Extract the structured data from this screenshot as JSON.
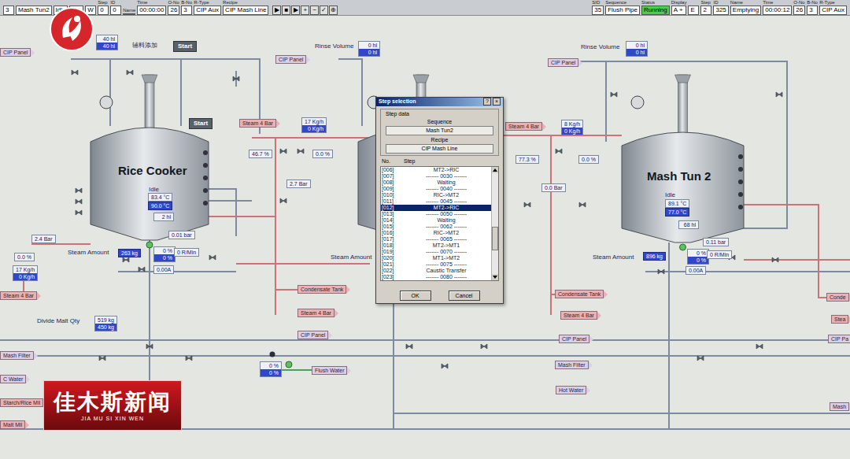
{
  "toolbar": {
    "left_cells": [
      {
        "value": "3"
      },
      {
        "value": "Mash Tun2"
      },
      {
        "value": "Idle"
      },
      {
        "value": "A +"
      },
      {
        "value": "W"
      },
      {
        "header": "Step",
        "value": "0"
      },
      {
        "header": "ID",
        "value": "0"
      },
      {
        "header": "Name",
        "value": ""
      },
      {
        "header": "Time",
        "value": "00:00:00"
      },
      {
        "header": "O-No",
        "value": "26"
      },
      {
        "header": "B-No",
        "value": "3"
      },
      {
        "header": "R-Type",
        "value": "CIP Aux"
      },
      {
        "header": "Recipe",
        "value": "CIP Mash Line"
      }
    ],
    "controls": [
      "▶",
      "■",
      "▶",
      "+",
      "−",
      "✓",
      "⊕"
    ],
    "right_cells": [
      {
        "header": "SID",
        "value": "35"
      },
      {
        "header": "Sequence",
        "value": "Flush Pipe"
      },
      {
        "header": "Status",
        "value": "Running",
        "kind": "status"
      },
      {
        "header": "Display",
        "value": "A +"
      },
      {
        "value": "E"
      },
      {
        "header": "Step",
        "value": "2"
      },
      {
        "header": "ID",
        "value": "325"
      },
      {
        "header": "Name",
        "value": "Emptying"
      },
      {
        "header": "Time",
        "value": "00:00:12"
      },
      {
        "header": "O-No",
        "value": "26"
      },
      {
        "header": "B-No",
        "value": "3"
      },
      {
        "header": "R-Type",
        "value": "CIP Aux"
      }
    ]
  },
  "items": [
    {
      "kind": "dual",
      "top": "40 hl",
      "bottom": "40 hl"
    },
    {
      "kind": "text",
      "text": "辅料添加"
    },
    {
      "kind": "button",
      "text": "Start"
    },
    {
      "kind": "tag",
      "text": "CIP Panel",
      "color": "#d8d0e6"
    },
    {
      "kind": "button",
      "text": "Start"
    },
    {
      "kind": "title",
      "text": "Rice Cooker"
    },
    {
      "kind": "text",
      "text": "Idle"
    },
    {
      "kind": "value",
      "text": "83.4 °C"
    },
    {
      "kind": "setpoint",
      "text": "90.0 °C"
    },
    {
      "kind": "value",
      "text": "2 hl"
    },
    {
      "kind": "tag",
      "text": "Steam 4 Bar",
      "color": "#e9b3b6"
    },
    {
      "kind": "dual",
      "top": "17 Kg/h",
      "bottom": "0 Kg/h"
    },
    {
      "kind": "value",
      "text": "46.7 %"
    },
    {
      "kind": "value",
      "text": "0.0 %"
    },
    {
      "kind": "value",
      "text": "2.7 Bar"
    },
    {
      "kind": "value",
      "text": "2.4 Bar"
    },
    {
      "kind": "value",
      "text": "0.01 bar"
    },
    {
      "kind": "text",
      "text": "Steam Amount"
    },
    {
      "kind": "setpoint",
      "text": "263 kg"
    },
    {
      "kind": "dual",
      "top": "0 %",
      "bottom": "0 %"
    },
    {
      "kind": "value",
      "text": "0 R/Min"
    },
    {
      "kind": "value",
      "text": "0.00A"
    },
    {
      "kind": "value",
      "text": "0.0 %"
    },
    {
      "kind": "dual",
      "top": "17 Kg/h",
      "bottom": "0 Kg/h"
    },
    {
      "kind": "tag",
      "text": "Steam 4 Bar",
      "color": "#e9b3b6"
    },
    {
      "kind": "tag",
      "text": "Condensate Tank",
      "color": "#e9b3b6"
    },
    {
      "kind": "tag",
      "text": "Steam 4 Bar",
      "color": "#e9b3b6"
    },
    {
      "kind": "text",
      "text": "Divide Malt Qty"
    },
    {
      "kind": "dual",
      "top": "519 kg",
      "bottom": "450 kg"
    },
    {
      "kind": "tag",
      "text": "CIP Panel",
      "color": "#d8d0e6"
    },
    {
      "kind": "tag",
      "text": "Mash Filter",
      "color": "#d8d0e6"
    },
    {
      "kind": "tag",
      "text": "C Water",
      "color": "#d8d0e6"
    },
    {
      "kind": "tag",
      "text": "Starch/Rice Mil",
      "color": "#e9b3b6"
    },
    {
      "kind": "tag",
      "text": "Malt Mil",
      "color": "#e9b3b6"
    },
    {
      "kind": "dual",
      "top": "0 %",
      "bottom": "0 %"
    },
    {
      "kind": "tag",
      "text": "Flush Water",
      "color": "#d8d0e6"
    },
    {
      "kind": "text",
      "text": "Rinse Volume"
    },
    {
      "kind": "dual",
      "top": "0 hl",
      "bottom": "0 hl"
    },
    {
      "kind": "tag",
      "text": "CIP Panel",
      "color": "#d8d0e6"
    },
    {
      "kind": "text",
      "text": "Steam Amount"
    },
    {
      "kind": "tag",
      "text": "Steam 4 Bar",
      "color": "#e9b3b6"
    },
    {
      "kind": "dual",
      "top": "8 Kg/h",
      "bottom": "0 Kg/h"
    },
    {
      "kind": "value",
      "text": "77.3 %"
    },
    {
      "kind": "value",
      "text": "0.0 %"
    },
    {
      "kind": "value",
      "text": "0.0 Bar"
    },
    {
      "kind": "tag",
      "text": "Condensate Tank",
      "color": "#e9b3b6"
    },
    {
      "kind": "tag",
      "text": "Steam 4 Bar",
      "color": "#e9b3b6"
    },
    {
      "kind": "tag",
      "text": "CIP Panel",
      "color": "#d8d0e6"
    },
    {
      "kind": "tag",
      "text": "Mash Filter",
      "color": "#d8d0e6"
    },
    {
      "kind": "tag",
      "text": "Hot Water",
      "color": "#d8d0e6"
    },
    {
      "kind": "text",
      "text": "Rinse Volume"
    },
    {
      "kind": "dual",
      "top": "0 hl",
      "bottom": "0 hl"
    },
    {
      "kind": "tag",
      "text": "CIP Panel",
      "color": "#d8d0e6"
    },
    {
      "kind": "title",
      "text": "Mash Tun 2"
    },
    {
      "kind": "text",
      "text": "Idle"
    },
    {
      "kind": "value",
      "text": "89.1 °C"
    },
    {
      "kind": "setpoint",
      "text": "77.0 °C"
    },
    {
      "kind": "value",
      "text": "68 hl"
    },
    {
      "kind": "value",
      "text": "0.11 bar"
    },
    {
      "kind": "text",
      "text": "Steam Amount"
    },
    {
      "kind": "setpoint",
      "text": "896 kg"
    },
    {
      "kind": "dual",
      "top": "0 %",
      "bottom": "0 %"
    },
    {
      "kind": "value",
      "text": "0 R/Min"
    },
    {
      "kind": "value",
      "text": "0.00A"
    },
    {
      "kind": "tag",
      "text": "Conde",
      "color": "#e9b3b6"
    },
    {
      "kind": "tag",
      "text": "Stea",
      "color": "#e9b3b6"
    },
    {
      "kind": "tag",
      "text": "CIP Pa",
      "color": "#d8d0e6"
    },
    {
      "kind": "tag",
      "text": "Mash",
      "color": "#d8d0e6"
    }
  ],
  "dialog": {
    "title": "Step selection",
    "title_buttons": [
      "?",
      "×"
    ],
    "group": "Step data",
    "sequence_label": "Sequence",
    "sequence": "Mash Tun2",
    "recipe_label": "Recipe",
    "recipe": "CIP Mash Line",
    "columns": [
      "No.",
      "Step"
    ],
    "rows": [
      {
        "no": "[006]",
        "step": "MT2->RIC",
        "selected": false
      },
      {
        "no": "[007]",
        "step": "------- 0030 -------",
        "selected": false
      },
      {
        "no": "[008]",
        "step": "Waiting",
        "selected": false
      },
      {
        "no": "[009]",
        "step": "------- 0040 -------",
        "selected": false
      },
      {
        "no": "[010]",
        "step": "RIC->MT2",
        "selected": false
      },
      {
        "no": "[011]",
        "step": "------- 0045 -------",
        "selected": false
      },
      {
        "no": "[012]",
        "step": "MT2->RIC",
        "selected": true
      },
      {
        "no": "[013]",
        "step": "------- 0050 -------",
        "selected": false
      },
      {
        "no": "[014]",
        "step": "Waiting",
        "selected": false
      },
      {
        "no": "[015]",
        "step": "------- 0062 -------",
        "selected": false
      },
      {
        "no": "[016]",
        "step": "RIC->MT2",
        "selected": false
      },
      {
        "no": "[017]",
        "step": "------- 0065 -------",
        "selected": false
      },
      {
        "no": "[018]",
        "step": "MT2->MT1",
        "selected": false
      },
      {
        "no": "[019]",
        "step": "------- 0070 -------",
        "selected": false
      },
      {
        "no": "[020]",
        "step": "MT1->MT2",
        "selected": false
      },
      {
        "no": "[021]",
        "step": "------- 0075 -------",
        "selected": false
      },
      {
        "no": "[022]",
        "step": "Caustic Transfer",
        "selected": false
      },
      {
        "no": "[023]",
        "step": "------- 0080 -------",
        "selected": false
      }
    ],
    "scroll_level": 0.7,
    "buttons": [
      "OK",
      "Cancel"
    ]
  },
  "news_banner": {
    "title": "佳木斯新闻",
    "subtitle": "JIA MU SI XIN WEN"
  }
}
